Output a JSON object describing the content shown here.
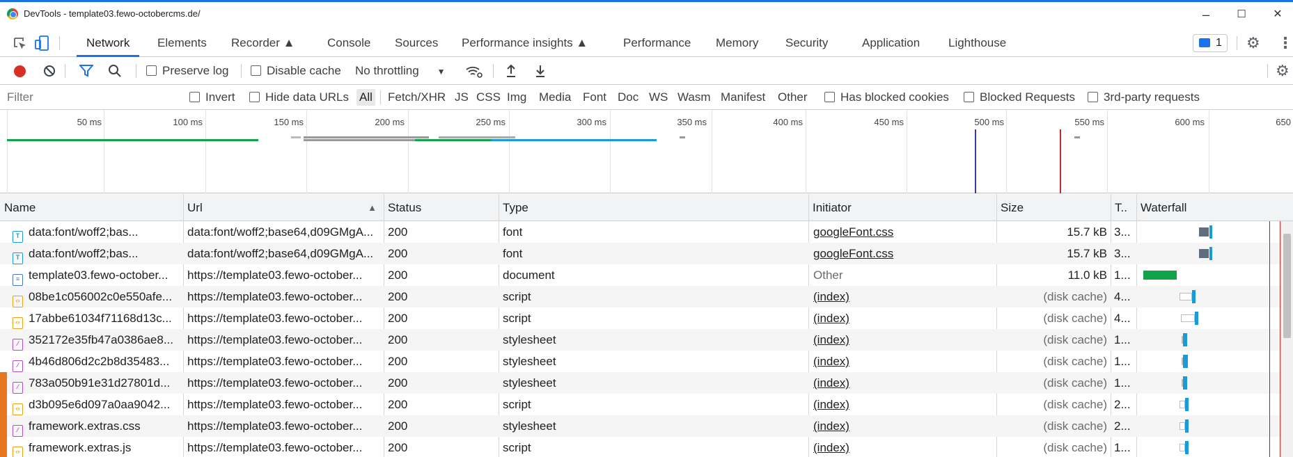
{
  "window": {
    "title": "DevTools - template03.fewo-octobercms.de/",
    "minimize": "–",
    "maximize": "☐",
    "close": "✕"
  },
  "tabs": [
    {
      "label": "Network",
      "active": true
    },
    {
      "label": "Elements"
    },
    {
      "label": "Recorder ▲"
    },
    {
      "label": "Console"
    },
    {
      "label": "Sources"
    },
    {
      "label": "Performance insights ▲"
    },
    {
      "label": "Performance"
    },
    {
      "label": "Memory"
    },
    {
      "label": "Security"
    },
    {
      "label": "Application"
    },
    {
      "label": "Lighthouse"
    }
  ],
  "issues_count": "1",
  "toolbar": {
    "preserve_log": "Preserve log",
    "disable_cache": "Disable cache",
    "throttling": "No throttling"
  },
  "filter": {
    "placeholder": "Filter",
    "invert": "Invert",
    "hide_data_urls": "Hide data URLs",
    "types": [
      "All",
      "Fetch/XHR",
      "JS",
      "CSS",
      "Img",
      "Media",
      "Font",
      "Doc",
      "WS",
      "Wasm",
      "Manifest",
      "Other"
    ],
    "has_blocked_cookies": "Has blocked cookies",
    "blocked_requests": "Blocked Requests",
    "third_party": "3rd-party requests"
  },
  "overview": {
    "ticks": [
      "50 ms",
      "100 ms",
      "150 ms",
      "200 ms",
      "250 ms",
      "300 ms",
      "350 ms",
      "400 ms",
      "450 ms",
      "500 ms",
      "550 ms",
      "600 ms",
      "650"
    ]
  },
  "columns": {
    "name": "Name",
    "url": "Url",
    "sort_arrow": "▲",
    "status": "Status",
    "type": "Type",
    "initiator": "Initiator",
    "size": "Size",
    "time": "T..",
    "waterfall": "Waterfall"
  },
  "rows": [
    {
      "icon": "font",
      "name": "data:font/woff2;bas...",
      "url": "data:font/woff2;base64,d09GMgA...",
      "status": "200",
      "type": "font",
      "initiator": "googleFont.css",
      "initiator_link": true,
      "size": "15.7 kB",
      "time": "3..."
    },
    {
      "icon": "font",
      "name": "data:font/woff2;bas...",
      "url": "data:font/woff2;base64,d09GMgA...",
      "status": "200",
      "type": "font",
      "initiator": "googleFont.css",
      "initiator_link": true,
      "size": "15.7 kB",
      "time": "3..."
    },
    {
      "icon": "document",
      "name": "template03.fewo-october...",
      "url": "https://template03.fewo-october...",
      "status": "200",
      "type": "document",
      "initiator": "Other",
      "initiator_link": false,
      "size": "11.0 kB",
      "time": "1..."
    },
    {
      "icon": "script",
      "name": "08be1c056002c0e550afe...",
      "url": "https://template03.fewo-october...",
      "status": "200",
      "type": "script",
      "initiator": "(index)",
      "initiator_link": true,
      "size": "(disk cache)",
      "time": "4..."
    },
    {
      "icon": "script",
      "name": "17abbe61034f71168d13c...",
      "url": "https://template03.fewo-october...",
      "status": "200",
      "type": "script",
      "initiator": "(index)",
      "initiator_link": true,
      "size": "(disk cache)",
      "time": "4..."
    },
    {
      "icon": "stylesheet",
      "name": "352172e35fb47a0386ae8...",
      "url": "https://template03.fewo-october...",
      "status": "200",
      "type": "stylesheet",
      "initiator": "(index)",
      "initiator_link": true,
      "size": "(disk cache)",
      "time": "1..."
    },
    {
      "icon": "stylesheet",
      "name": "4b46d806d2c2b8d35483...",
      "url": "https://template03.fewo-october...",
      "status": "200",
      "type": "stylesheet",
      "initiator": "(index)",
      "initiator_link": true,
      "size": "(disk cache)",
      "time": "1..."
    },
    {
      "icon": "stylesheet",
      "name": "783a050b91e31d27801d...",
      "url": "https://template03.fewo-october...",
      "status": "200",
      "type": "stylesheet",
      "initiator": "(index)",
      "initiator_link": true,
      "size": "(disk cache)",
      "time": "1..."
    },
    {
      "icon": "script",
      "name": "d3b095e6d097a0aa9042...",
      "url": "https://template03.fewo-october...",
      "status": "200",
      "type": "script",
      "initiator": "(index)",
      "initiator_link": true,
      "size": "(disk cache)",
      "time": "2..."
    },
    {
      "icon": "stylesheet",
      "name": "framework.extras.css",
      "url": "https://template03.fewo-october...",
      "status": "200",
      "type": "stylesheet",
      "initiator": "(index)",
      "initiator_link": true,
      "size": "(disk cache)",
      "time": "2..."
    },
    {
      "icon": "script",
      "name": "framework.extras.js",
      "url": "https://template03.fewo-october...",
      "status": "200",
      "type": "script",
      "initiator": "(index)",
      "initiator_link": true,
      "size": "(disk cache)",
      "time": "1..."
    }
  ],
  "colors": {
    "accent": "#1a73e8",
    "record": "#d93025",
    "font_icon": "#1a9ad6",
    "document_icon": "#4a78c2",
    "script_icon": "#e8a317",
    "stylesheet_icon": "#b04cc6"
  }
}
